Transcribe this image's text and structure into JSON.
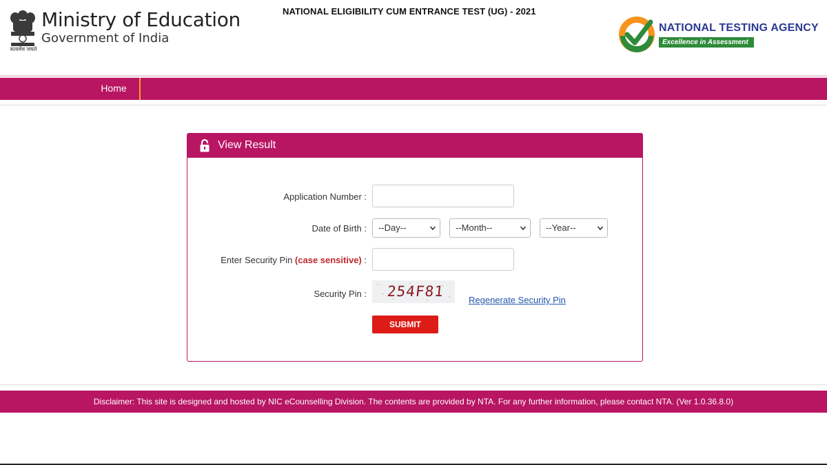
{
  "header": {
    "ministry_title": "Ministry of Education",
    "ministry_subtitle": "Government of India",
    "emblem_caption": "सत्यमेव जयते",
    "exam_title": "NATIONAL ELIGIBILITY CUM ENTRANCE TEST (UG) - 2021",
    "agency_name": "NATIONAL TESTING AGENCY",
    "agency_tagline": "Excellence in Assessment"
  },
  "nav": {
    "items": [
      {
        "label": "Home"
      }
    ]
  },
  "form": {
    "title": "View Result",
    "application_number_label": "Application Number :",
    "application_number_value": "",
    "dob_label": "Date of Birth :",
    "day_selected": "--Day--",
    "month_selected": "--Month--",
    "year_selected": "--Year--",
    "security_pin_input_label": "Enter Security Pin ",
    "case_sensitive_note": "(case sensitive)",
    "security_pin_input_label_suffix": " :",
    "security_pin_value": "",
    "captcha_label": "Security Pin :",
    "captcha_text": "254F81",
    "regenerate_link": "Regenerate Security Pin",
    "submit_label": "SUBMIT"
  },
  "footer": {
    "disclaimer": "Disclaimer: This site is designed and hosted by NIC eCounselling Division. The contents are provided by NTA. For any further information, please contact NTA. (Ver 1.0.36.8.0)"
  },
  "colors": {
    "brand_magenta": "#b81563",
    "submit_red": "#dd1b17",
    "nta_blue": "#2b3990",
    "nta_green": "#2e8b3a",
    "nav_separator_orange": "#f5a623",
    "link_blue": "#2255aa"
  },
  "icons": {
    "emblem": "national-emblem-icon",
    "nta_logo": "nta-checkmark-logo-icon",
    "panel_lock": "lock-icon",
    "select_chevron": "chevron-down-icon"
  }
}
